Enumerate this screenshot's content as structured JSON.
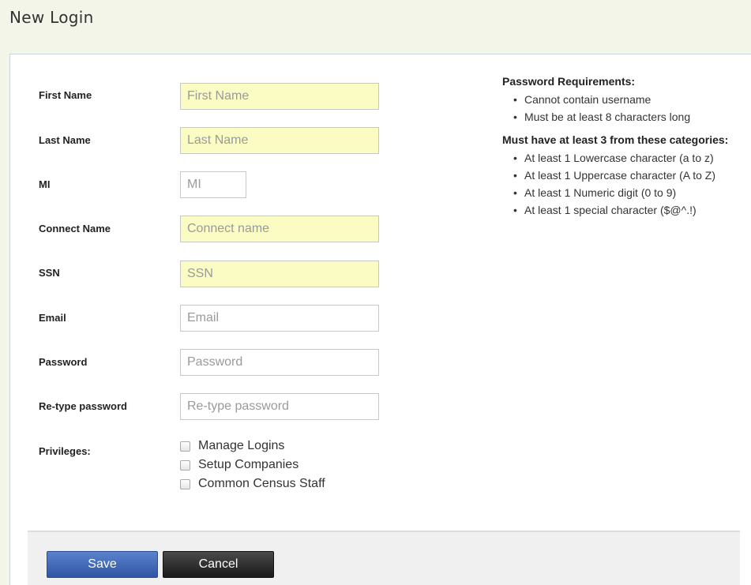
{
  "page": {
    "title": "New Login"
  },
  "form": {
    "fields": [
      {
        "label": "First Name",
        "placeholder": "First Name"
      },
      {
        "label": "Last Name",
        "placeholder": "Last Name"
      },
      {
        "label": "MI",
        "placeholder": "MI"
      },
      {
        "label": "Connect Name",
        "placeholder": "Connect name"
      },
      {
        "label": "SSN",
        "placeholder": "SSN"
      },
      {
        "label": "Email",
        "placeholder": "Email"
      },
      {
        "label": "Password",
        "placeholder": "Password"
      },
      {
        "label": "Re-type password",
        "placeholder": "Re-type password"
      }
    ],
    "privileges": {
      "label": "Privileges:",
      "options": [
        "Manage Logins",
        "Setup Companies",
        "Common Census Staff"
      ]
    }
  },
  "requirements": {
    "heading": "Password Requirements:",
    "items": [
      "Cannot contain username",
      "Must be at least 8 characters long"
    ],
    "categories_heading": "Must have at least 3 from these categories:",
    "categories": [
      "At least 1 Lowercase character (a to z)",
      "At least 1 Uppercase character (A to Z)",
      "At least 1 Numeric digit (0 to 9)",
      "At least 1 special character ($@^.!)"
    ]
  },
  "buttons": {
    "save": "Save",
    "cancel": "Cancel"
  },
  "colors": {
    "page_background": "#f3f5e9",
    "required_field": "#fbfbc4",
    "save_button": "#3d63b2",
    "cancel_button": "#2b2b2b"
  }
}
